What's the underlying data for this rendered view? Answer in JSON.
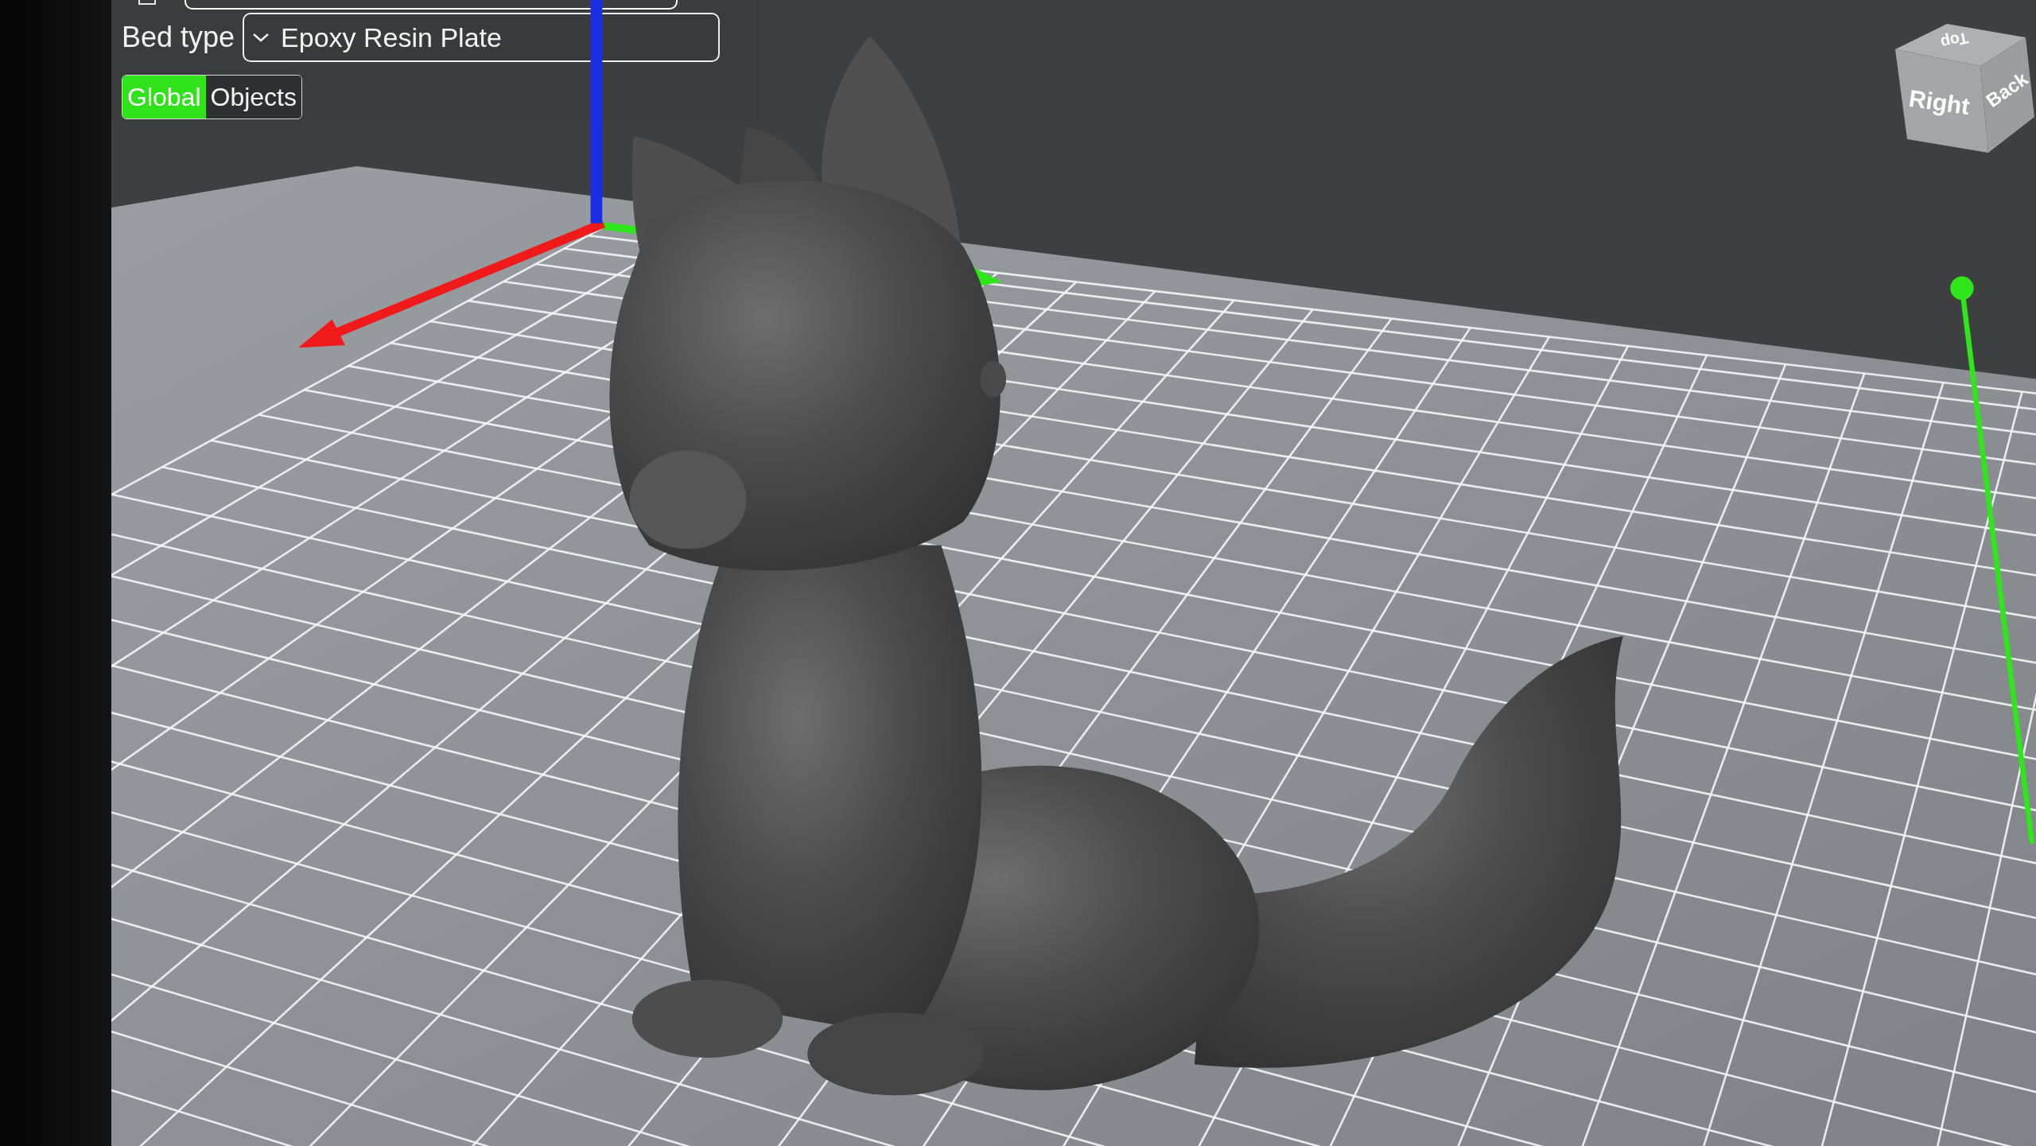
{
  "settings_panel": {
    "bed_type": {
      "label": "Bed type",
      "value": "Epoxy Resin Plate"
    },
    "scope_tabs": [
      {
        "label": "Global",
        "selected": true
      },
      {
        "label": "Objects",
        "selected": false
      }
    ]
  },
  "view_cube": {
    "faces": [
      {
        "kind": "top",
        "label": "Top"
      },
      {
        "kind": "right",
        "label": "Right"
      },
      {
        "kind": "back",
        "label": "Back"
      }
    ]
  }
}
